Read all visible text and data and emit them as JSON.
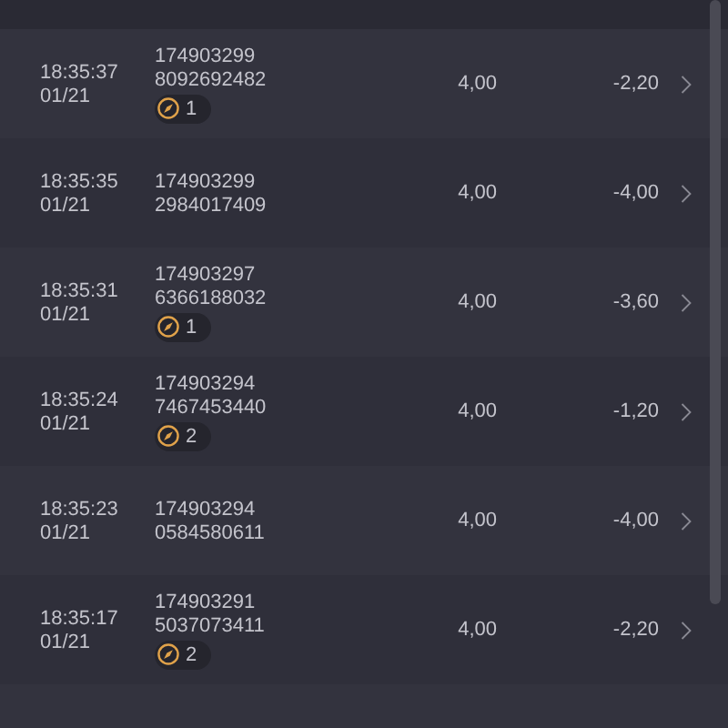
{
  "rows": [
    {
      "time": "18:35:37",
      "date": "01/21",
      "id_line_1": "174903299",
      "id_line_2": "8092692482",
      "badge": "1",
      "stake": "4,00",
      "result": "-2,20"
    },
    {
      "time": "18:35:35",
      "date": "01/21",
      "id_line_1": "174903299",
      "id_line_2": "2984017409",
      "stake": "4,00",
      "result": "-4,00"
    },
    {
      "time": "18:35:31",
      "date": "01/21",
      "id_line_1": "174903297",
      "id_line_2": "6366188032",
      "badge": "1",
      "stake": "4,00",
      "result": "-3,60"
    },
    {
      "time": "18:35:24",
      "date": "01/21",
      "id_line_1": "174903294",
      "id_line_2": "7467453440",
      "badge": "2",
      "stake": "4,00",
      "result": "-1,20"
    },
    {
      "time": "18:35:23",
      "date": "01/21",
      "id_line_1": "174903294",
      "id_line_2": "0584580611",
      "stake": "4,00",
      "result": "-4,00"
    },
    {
      "time": "18:35:17",
      "date": "01/21",
      "id_line_1": "174903291",
      "id_line_2": "5037073411",
      "badge": "2",
      "stake": "4,00",
      "result": "-2,20"
    }
  ]
}
